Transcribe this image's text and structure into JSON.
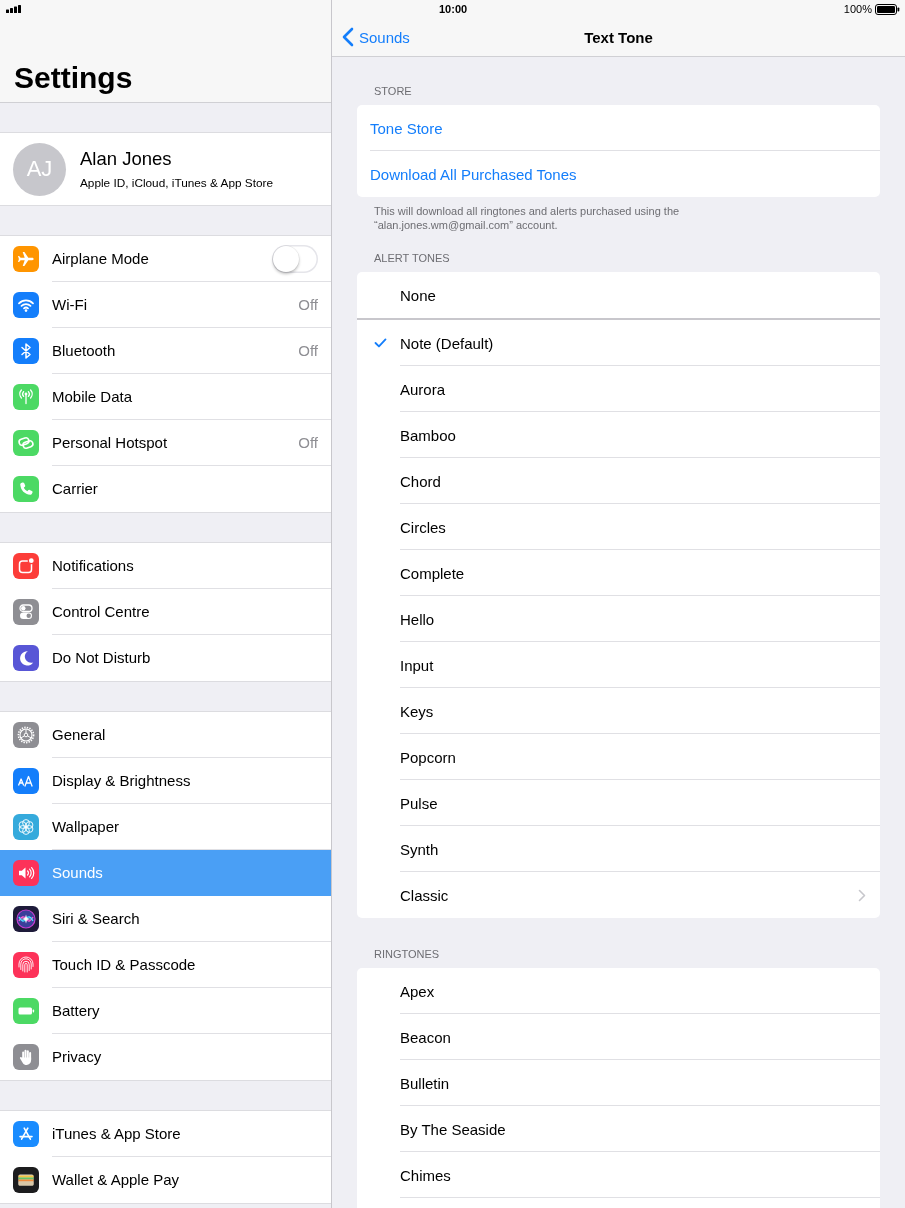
{
  "status_bar": {
    "time": "10:00",
    "battery_percent": "100%"
  },
  "sidebar": {
    "title": "Settings",
    "profile": {
      "initials": "AJ",
      "name": "Alan Jones",
      "subtitle": "Apple ID, iCloud, iTunes & App Store"
    },
    "groups": [
      {
        "items": [
          {
            "label": "Airplane Mode",
            "kind": "switch",
            "on": false,
            "color": "#ff9500",
            "selected": false
          },
          {
            "label": "Wi-Fi",
            "kind": "link",
            "value": "Off",
            "color": "#147efb",
            "selected": false
          },
          {
            "label": "Bluetooth",
            "kind": "link",
            "value": "Off",
            "color": "#147efb",
            "selected": false
          },
          {
            "label": "Mobile Data",
            "kind": "link",
            "color": "#4cd964",
            "selected": false
          },
          {
            "label": "Personal Hotspot",
            "kind": "link",
            "value": "Off",
            "color": "#4cd964",
            "selected": false
          },
          {
            "label": "Carrier",
            "kind": "link",
            "color": "#4cd964",
            "selected": false
          }
        ]
      },
      {
        "items": [
          {
            "label": "Notifications",
            "kind": "link",
            "color": "#fc3d39",
            "selected": false
          },
          {
            "label": "Control Centre",
            "kind": "link",
            "color": "#8e8e93",
            "selected": false
          },
          {
            "label": "Do Not Disturb",
            "kind": "link",
            "color": "#5856d6",
            "selected": false
          }
        ]
      },
      {
        "items": [
          {
            "label": "General",
            "kind": "link",
            "color": "#8e8e93",
            "selected": false
          },
          {
            "label": "Display & Brightness",
            "kind": "link",
            "color": "#147efb",
            "selected": false
          },
          {
            "label": "Wallpaper",
            "kind": "link",
            "color": "#35aadc",
            "selected": false
          },
          {
            "label": "Sounds",
            "kind": "link",
            "color": "#fd3259",
            "selected": true
          },
          {
            "label": "Siri & Search",
            "kind": "link",
            "color": "#1e1b3a",
            "selected": false
          },
          {
            "label": "Touch ID & Passcode",
            "kind": "link",
            "color": "#fd3259",
            "selected": false
          },
          {
            "label": "Battery",
            "kind": "link",
            "color": "#4cd964",
            "selected": false
          },
          {
            "label": "Privacy",
            "kind": "link",
            "color": "#8e8e93",
            "selected": false
          }
        ]
      },
      {
        "items": [
          {
            "label": "iTunes & App Store",
            "kind": "link",
            "color": "#1a8cff",
            "selected": false
          },
          {
            "label": "Wallet & Apple Pay",
            "kind": "link",
            "color": "#1c1c1e",
            "selected": false
          }
        ]
      }
    ]
  },
  "detail": {
    "back": "Sounds",
    "title": "Text Tone",
    "sections": [
      {
        "header": "STORE",
        "rows": [
          {
            "kind": "action",
            "label": "Tone Store"
          },
          {
            "kind": "action",
            "label": "Download All Purchased Tones"
          }
        ],
        "footer": "This will download all ringtones and alerts purchased using the “alan.jones.wm@gmail.com” account."
      },
      {
        "header": "ALERT TONES",
        "none_row": {
          "label": "None",
          "selected": false
        },
        "rows": [
          {
            "kind": "tone",
            "label": "Note (Default)",
            "selected": true
          },
          {
            "kind": "tone",
            "label": "Aurora",
            "selected": false
          },
          {
            "kind": "tone",
            "label": "Bamboo",
            "selected": false
          },
          {
            "kind": "tone",
            "label": "Chord",
            "selected": false
          },
          {
            "kind": "tone",
            "label": "Circles",
            "selected": false
          },
          {
            "kind": "tone",
            "label": "Complete",
            "selected": false
          },
          {
            "kind": "tone",
            "label": "Hello",
            "selected": false
          },
          {
            "kind": "tone",
            "label": "Input",
            "selected": false
          },
          {
            "kind": "tone",
            "label": "Keys",
            "selected": false
          },
          {
            "kind": "tone",
            "label": "Popcorn",
            "selected": false
          },
          {
            "kind": "tone",
            "label": "Pulse",
            "selected": false
          },
          {
            "kind": "tone",
            "label": "Synth",
            "selected": false
          },
          {
            "kind": "folder",
            "label": "Classic",
            "selected": false
          }
        ]
      },
      {
        "header": "RINGTONES",
        "rows": [
          {
            "kind": "tone",
            "label": "Apex",
            "selected": false
          },
          {
            "kind": "tone",
            "label": "Beacon",
            "selected": false
          },
          {
            "kind": "tone",
            "label": "Bulletin",
            "selected": false
          },
          {
            "kind": "tone",
            "label": "By The Seaside",
            "selected": false
          },
          {
            "kind": "tone",
            "label": "Chimes",
            "selected": false
          }
        ]
      }
    ]
  }
}
